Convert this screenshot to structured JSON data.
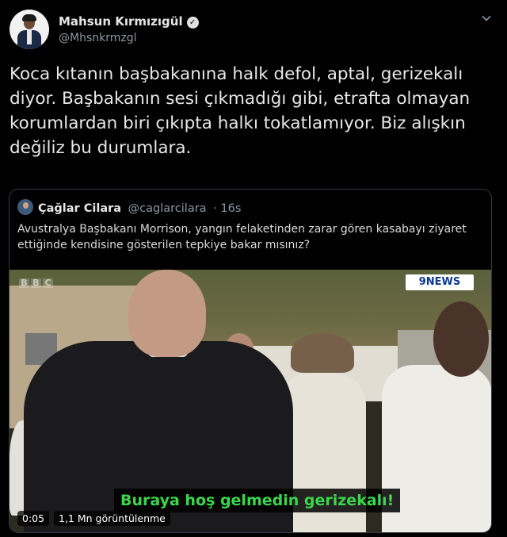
{
  "tweet": {
    "author_name": "Mahsun Kırmızıgül",
    "verified_mark": "✓",
    "handle": "@Mhsnkrmzgl",
    "text": "Koca kıtanın başbakanına halk defol,  aptal, gerizekalı diyor. Başbakanın sesi çıkmadığı gibi,  etrafta olmayan korumlardan biri çıkıpta halkı tokatlamıyor. Biz alışkın değiliz bu durumlara."
  },
  "quote": {
    "author_name": "Çağlar Cilara",
    "handle": "@caglarcilara",
    "time": "· 16s",
    "text": "Avustralya Başbakanı Morrison, yangın felaketinden zarar gören kasabayı ziyaret ettiğinde kendisine gösterilen tepkiye bakar mısınız?"
  },
  "video": {
    "bbc_letters": [
      "B",
      "B",
      "C"
    ],
    "news_logo": "9NEWS",
    "subtitle": "Buraya hoş gelmedin gerizekalı!",
    "elapsed": "0:05",
    "views": "1,1 Mn görüntülenme"
  },
  "icons": {
    "more": "chevron-down-icon",
    "verified": "verified-badge-icon"
  },
  "colors": {
    "background": "#000000",
    "secondary_text": "#8b98a5",
    "subtitle_green": "#39d84a"
  }
}
